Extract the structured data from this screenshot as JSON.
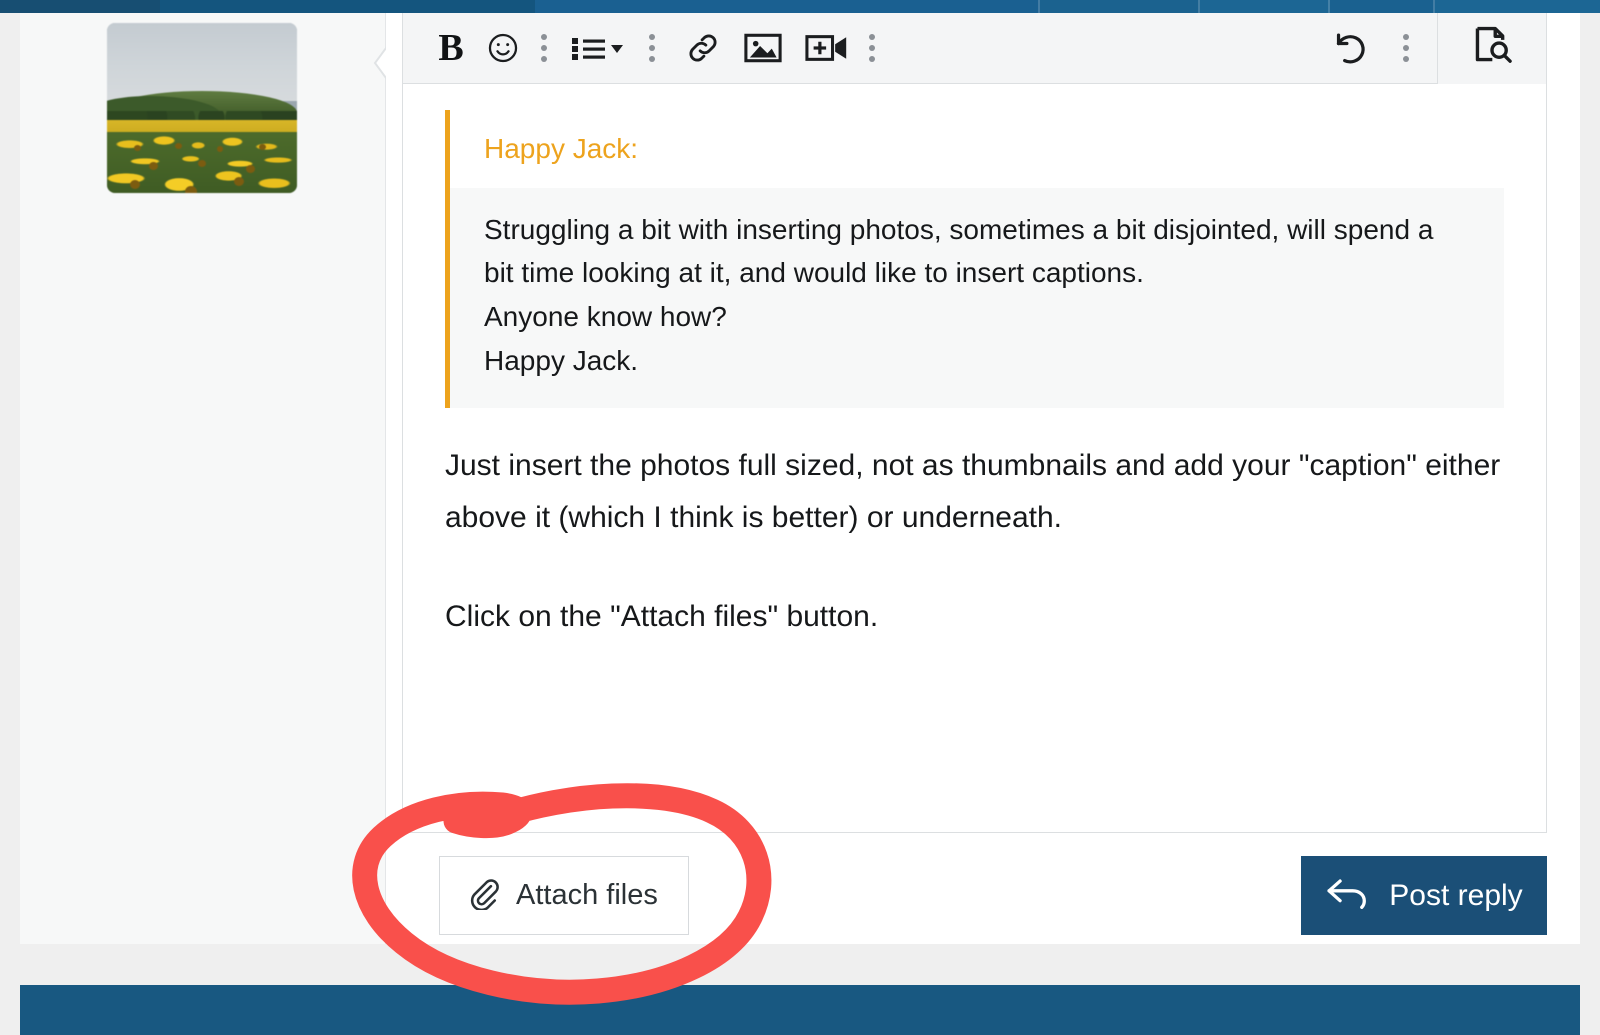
{
  "theme": {
    "brand_blue": "#185881",
    "post_button_blue": "#1b4f77",
    "quote_accent_orange": "#eda31d",
    "annotation_red": "#f9504b",
    "page_background": "#efefef",
    "card_background": "#f7f8f8",
    "editor_background": "#ffffff",
    "toolbar_background": "#f4f5f6",
    "border_grey": "#dcdfe1",
    "text_color": "#16181a"
  },
  "avatar": {
    "name": "user-avatar",
    "description": "sunflower field photo"
  },
  "toolbar": {
    "buttons": [
      {
        "icon": "bold-icon",
        "label": "B",
        "title": "Bold"
      },
      {
        "icon": "emoji-icon",
        "label": "",
        "title": "Insert emoji"
      },
      {
        "icon": "more-options-icon",
        "label": "",
        "title": "More options"
      },
      {
        "icon": "bullet-list-icon",
        "label": "",
        "title": "List"
      },
      {
        "icon": "more-options-icon",
        "label": "",
        "title": "More options"
      },
      {
        "icon": "link-icon",
        "label": "",
        "title": "Insert link"
      },
      {
        "icon": "image-icon",
        "label": "",
        "title": "Insert image"
      },
      {
        "icon": "video-icon",
        "label": "",
        "title": "Insert video"
      },
      {
        "icon": "more-options-icon",
        "label": "",
        "title": "More options"
      }
    ],
    "right_buttons": [
      {
        "icon": "undo-icon",
        "label": "",
        "title": "Undo"
      },
      {
        "icon": "more-options-icon",
        "label": "",
        "title": "More options"
      },
      {
        "icon": "preview-icon",
        "label": "",
        "title": "Preview"
      }
    ]
  },
  "editor": {
    "quote": {
      "author": "Happy Jack:",
      "lines": [
        "Struggling a bit with inserting photos, sometimes a bit disjointed, will spend a bit time looking at it,  and would like to insert captions.",
        "Anyone know how?",
        "Happy Jack."
      ]
    },
    "reply_paragraphs": [
      "Just insert the photos full sized, not as thumbnails and add your \"caption\" either above it (which I think is better) or underneath.",
      "Click on the \"Attach files\" button."
    ]
  },
  "actions": {
    "attach_label": "Attach files",
    "attach_icon": "paperclip-icon",
    "post_label": "Post reply",
    "post_icon": "reply-arrow-icon"
  },
  "annotation": {
    "type": "hand-drawn-ellipse",
    "target": "attach-files-button",
    "color": "#f9504b"
  }
}
